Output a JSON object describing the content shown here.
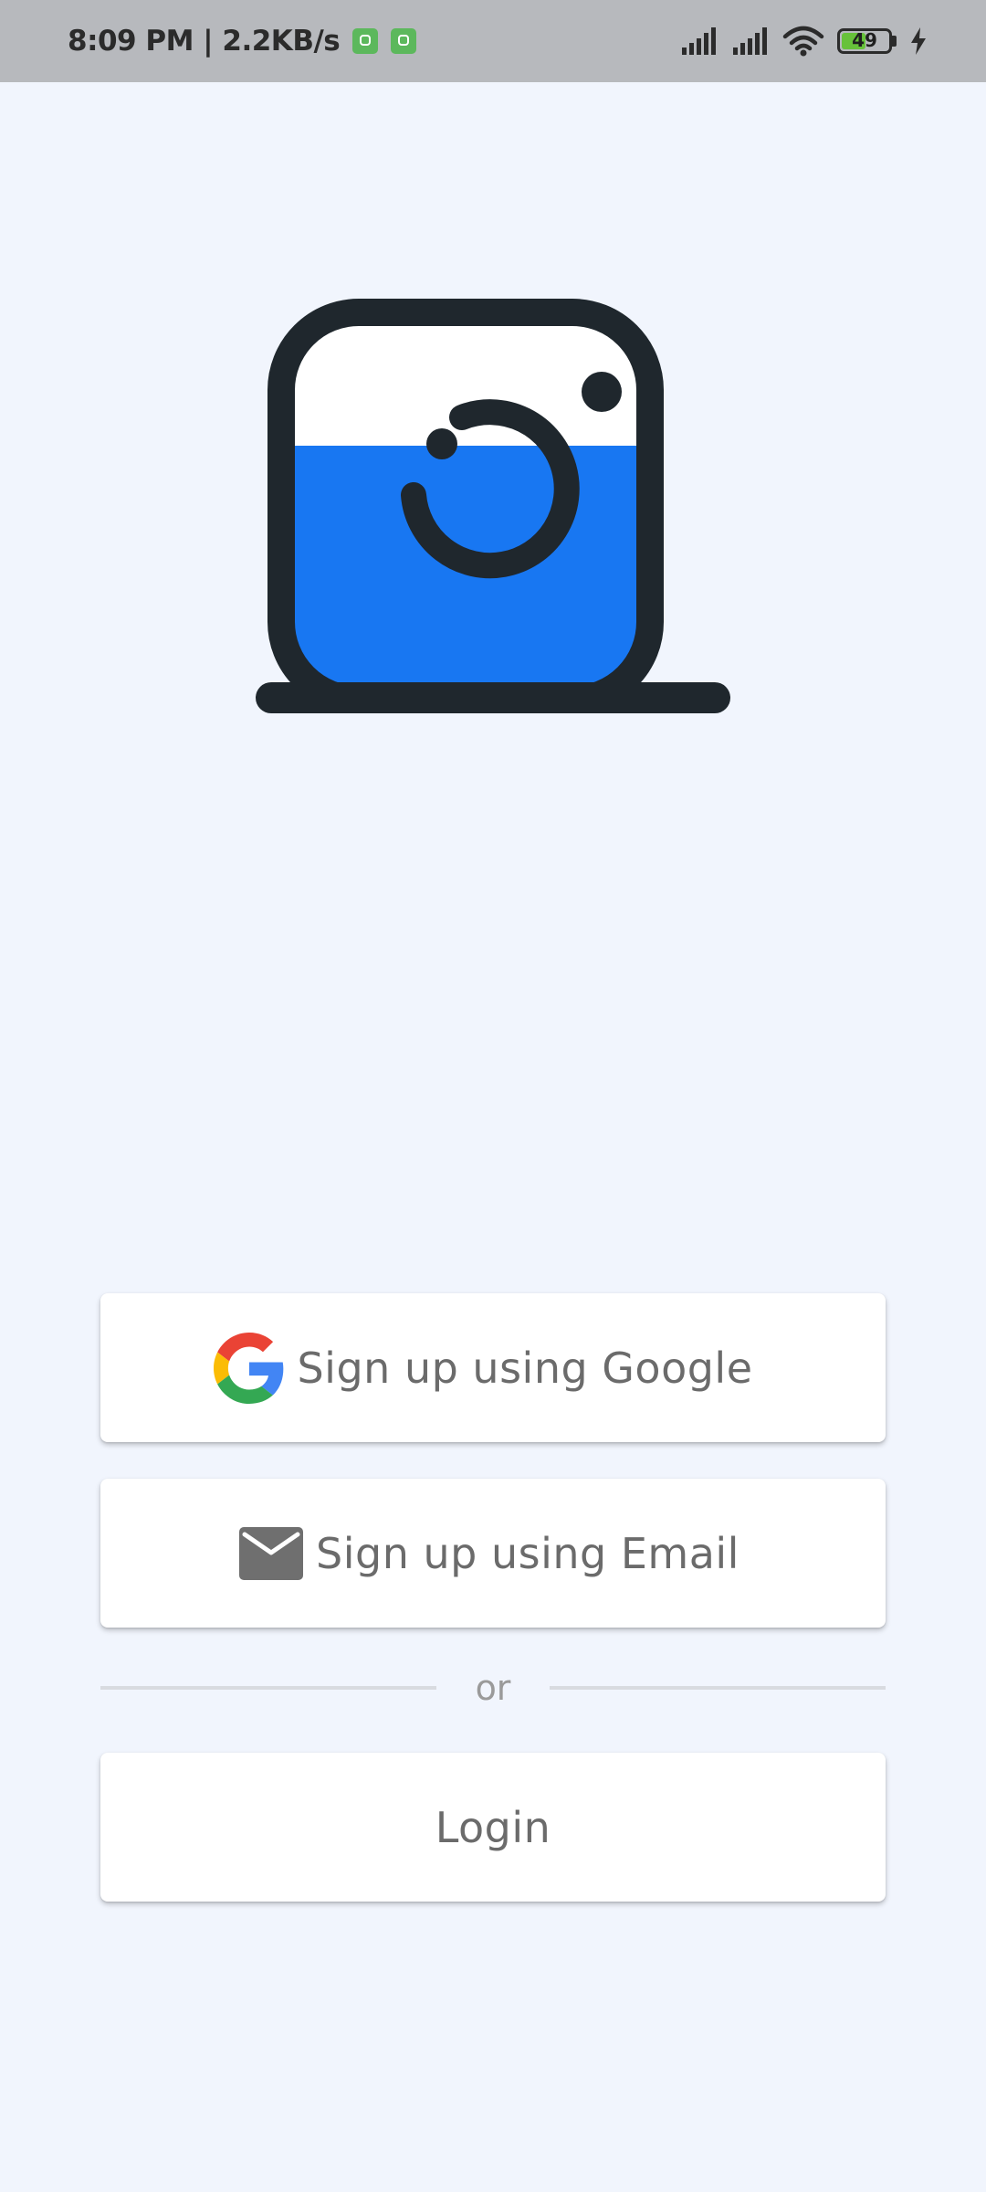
{
  "status_bar": {
    "time_speed": "8:09 PM | 2.2KB/s",
    "battery_level": "49",
    "icons": [
      "notification-icon",
      "notification-icon",
      "signal-icon",
      "signal-icon",
      "wifi-icon",
      "battery-icon",
      "charging-icon"
    ]
  },
  "logo": {
    "icon": "camera-logo-icon",
    "colors": {
      "outline": "#1f272d",
      "fill": "#1877f2",
      "top": "#ffffff"
    }
  },
  "actions": {
    "google_label": "Sign up using Google",
    "email_label": "Sign up using Email",
    "divider_label": "or",
    "login_label": "Login"
  },
  "colors": {
    "background": "#f1f5fd",
    "button_text": "#6b6b6b",
    "status_bar": "#b7b9bd"
  }
}
